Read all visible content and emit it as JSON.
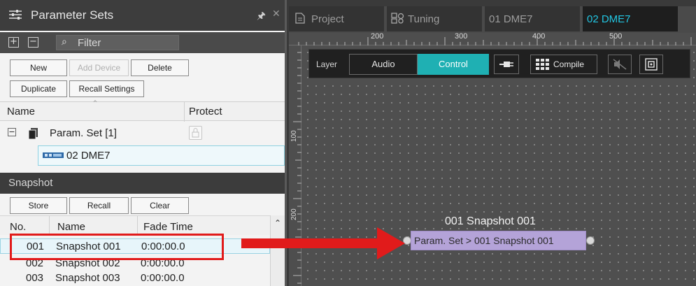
{
  "left_panel": {
    "title": "Parameter Sets",
    "filter_placeholder": "Filter",
    "buttons": {
      "new": "New",
      "add_device": "Add Device",
      "delete": "Delete",
      "duplicate": "Duplicate",
      "recall_settings": "Recall Settings"
    },
    "columns": {
      "name": "Name",
      "protect": "Protect"
    },
    "tree": {
      "set_label": "Param. Set [1]",
      "device_label": "02 DME7"
    },
    "snapshot": {
      "header": "Snapshot",
      "buttons": {
        "store": "Store",
        "recall": "Recall",
        "clear": "Clear"
      },
      "columns": {
        "no": "No.",
        "name": "Name",
        "fade_time": "Fade Time"
      },
      "rows": [
        {
          "no": "001",
          "name": "Snapshot 001",
          "fade": "0:00:00.0"
        },
        {
          "no": "002",
          "name": "Snapshot 002",
          "fade": "0:00:00.0"
        },
        {
          "no": "003",
          "name": "Snapshot 003",
          "fade": "0:00:00.0"
        }
      ]
    }
  },
  "tabs": [
    {
      "label": "Project",
      "active": false
    },
    {
      "label": "Tuning",
      "active": false
    },
    {
      "label": "01 DME7",
      "active": false
    },
    {
      "label": "02 DME7",
      "active": true
    }
  ],
  "ruler": {
    "top": [
      "200",
      "300",
      "400",
      "500"
    ],
    "left": [
      "100",
      "200"
    ]
  },
  "toolbar": {
    "layer_label": "Layer",
    "audio": "Audio",
    "control": "Control",
    "compile": "Compile"
  },
  "canvas": {
    "component_title": "001 Snapshot 001",
    "component_label": "Param. Set > 001 Snapshot 001"
  },
  "colors": {
    "accent": "#22c6e3",
    "control_on": "#1fb0b3",
    "component": "#b4a3d8",
    "highlight": "#e11b1b"
  }
}
